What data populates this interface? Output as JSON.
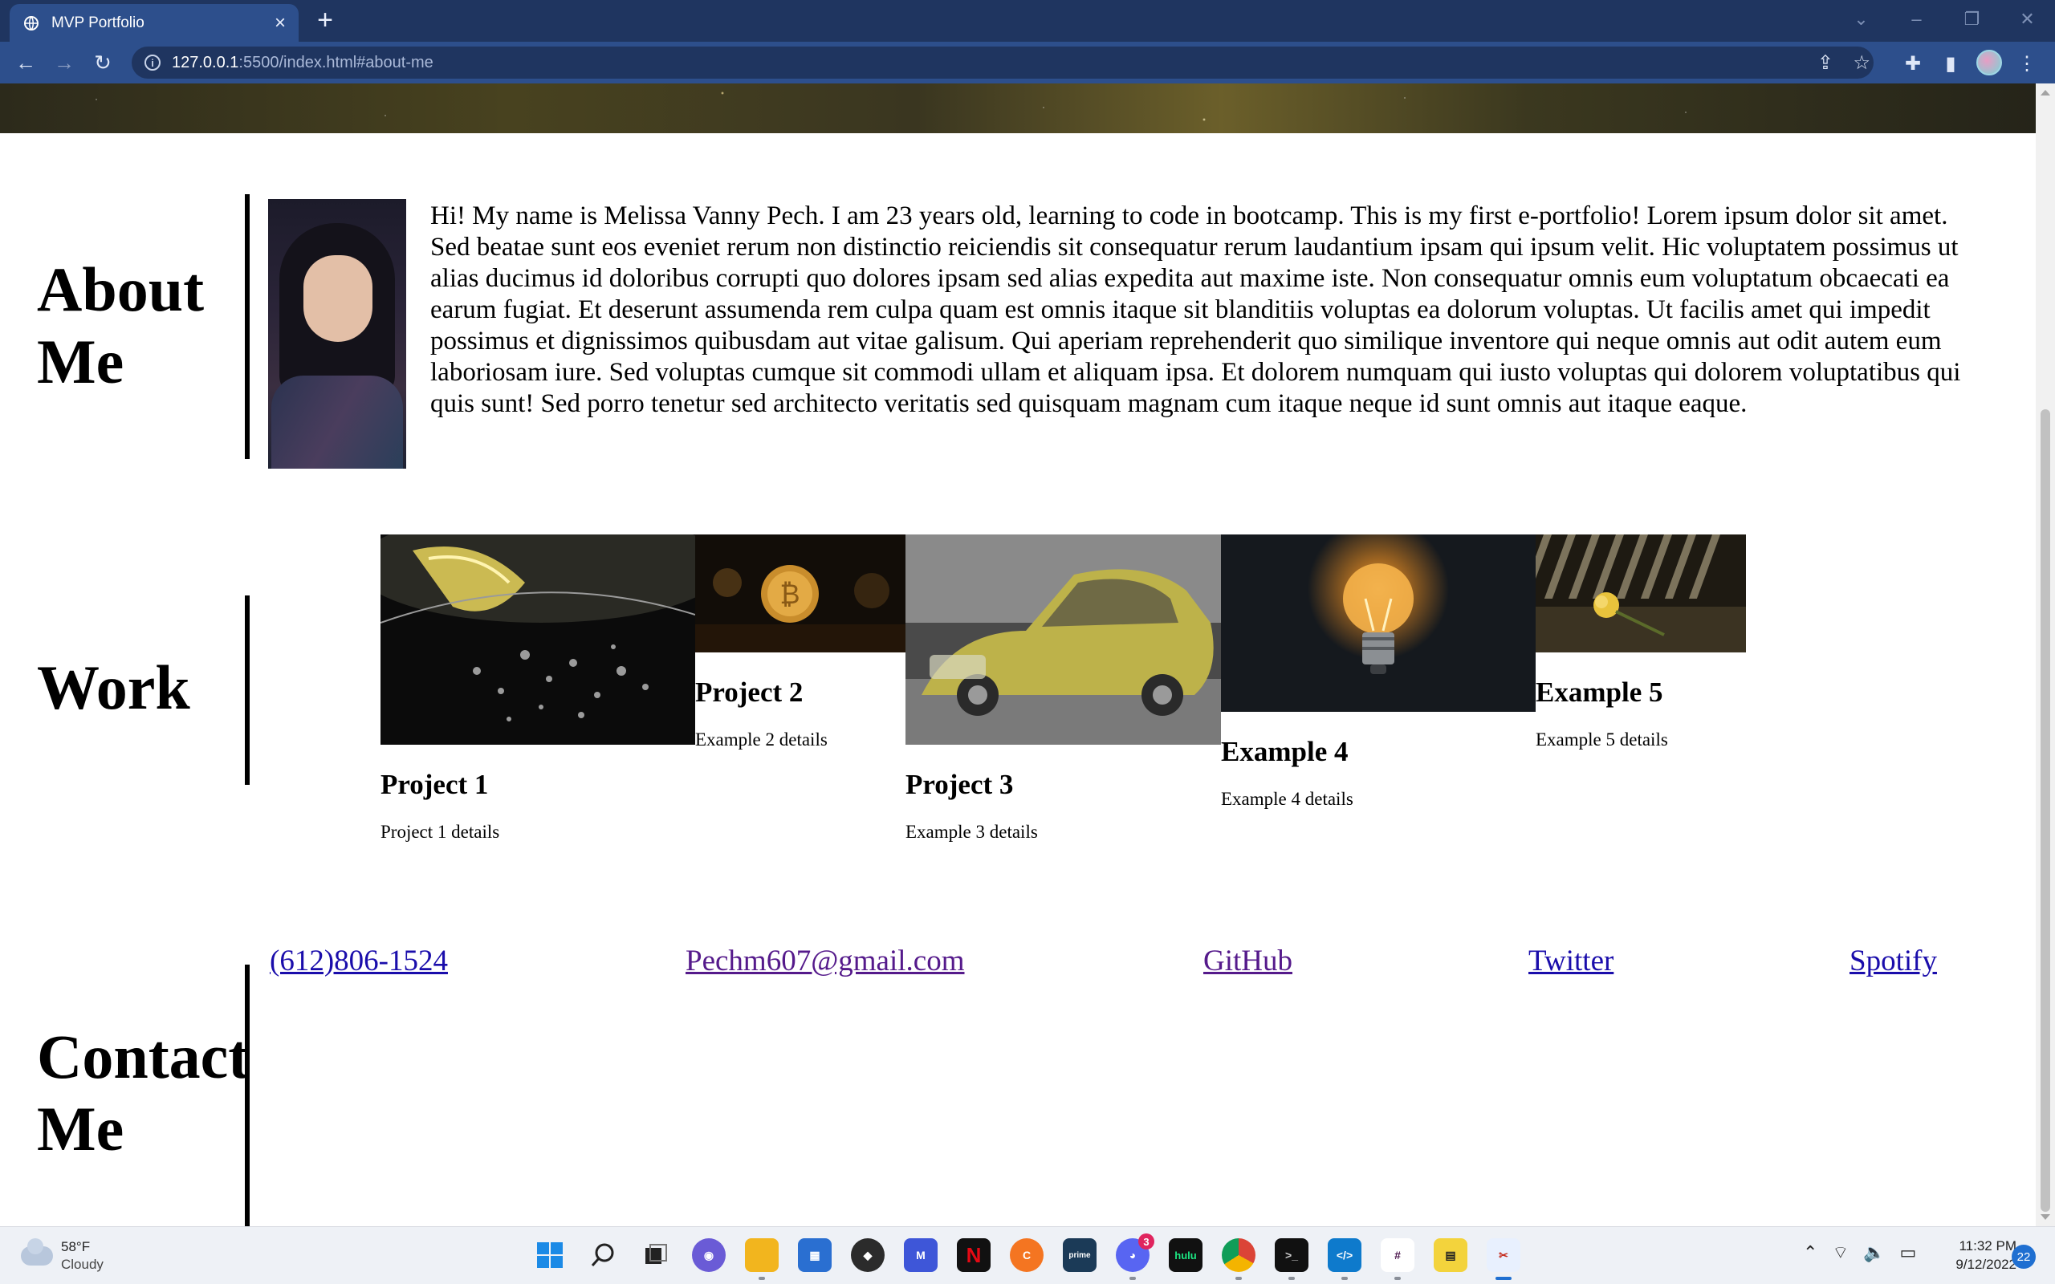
{
  "browser": {
    "tab_title": "MVP Portfolio",
    "new_tab": "+",
    "url_host": "127.0.0.1",
    "url_path": ":5500/index.html#about-me"
  },
  "about": {
    "title_line1": "About",
    "title_line2": "Me",
    "text": "Hi! My name is Melissa Vanny Pech. I am 23 years old, learning to code in bootcamp. This is my first e-portfolio! Lorem ipsum dolor sit amet. Sed beatae sunt eos eveniet rerum non distinctio reiciendis sit consequatur rerum laudantium ipsam qui ipsum velit. Hic voluptatem possimus ut alias ducimus id doloribus corrupti quo dolores ipsam sed alias expedita aut maxime iste. Non consequatur omnis eum voluptatum obcaecati ea earum fugiat. Et deserunt assumenda rem culpa quam est omnis itaque sit blanditiis voluptas ea dolorum voluptas. Ut facilis amet qui impedit possimus et dignissimos quibusdam aut vitae galisum. Qui aperiam reprehenderit quo similique inventore qui neque omnis aut odit autem eum laboriosam iure. Sed voluptas cumque sit commodi ullam et aliquam ipsa. Et dolorem numquam qui iusto voluptas qui dolorem voluptatibus qui quis sunt! Sed porro tenetur sed architecto veritatis sed quisquam magnam cum itaque neque id sunt omnis aut itaque eaque."
  },
  "work": {
    "title": "Work",
    "items": [
      {
        "title": "Project 1",
        "details": "Project 1 details"
      },
      {
        "title": "Project 2",
        "details": "Example 2 details"
      },
      {
        "title": "Project 3",
        "details": "Example 3 details"
      },
      {
        "title": "Example 4",
        "details": "Example 4 details"
      },
      {
        "title": "Example 5",
        "details": "Example 5 details"
      }
    ]
  },
  "contact": {
    "title_line1": "Contact",
    "title_line2": "Me",
    "links": [
      "(612)806-1524",
      "Pechm607@gmail.com",
      "GitHub",
      "Twitter",
      "Spotify"
    ]
  },
  "taskbar": {
    "temperature": "58°F",
    "condition": "Cloudy",
    "discord_badge": "3",
    "time": "11:32 PM",
    "date": "9/12/2022",
    "notifications": "22"
  }
}
